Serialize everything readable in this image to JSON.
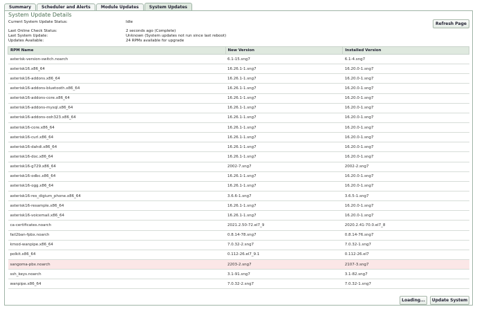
{
  "tabs": [
    {
      "label": "Summary",
      "active": false
    },
    {
      "label": "Scheduler and Alerts",
      "active": false
    },
    {
      "label": "Module Updates",
      "active": false
    },
    {
      "label": "System Updates",
      "active": true
    }
  ],
  "panel": {
    "title": "System Update Details",
    "status_label": "Current System Update Status:",
    "status_value": "Idle",
    "last_online_label": "Last Online Check Status:",
    "last_online_value": "2 seconds ago   (Complete)",
    "last_update_label": "Last System Update:",
    "last_update_value": "Unknown (System updates not run since last reboot)",
    "available_label": "Updates Available:",
    "available_value": "24 RPMs available for upgrade",
    "refresh_label": "Refresh Page"
  },
  "table": {
    "headers": [
      "RPM Name",
      "New Version",
      "Installed Version"
    ],
    "rows": [
      {
        "name": "asterisk-version-switch.noarch",
        "new": "6.1-15.sng7",
        "installed": "6.1-4.sng7"
      },
      {
        "name": "asterisk16.x86_64",
        "new": "16.26.1-1.sng7",
        "installed": "16.20.0-1.sng7"
      },
      {
        "name": "asterisk16-addons.x86_64",
        "new": "16.26.1-1.sng7",
        "installed": "16.20.0-1.sng7"
      },
      {
        "name": "asterisk16-addons-bluetooth.x86_64",
        "new": "16.26.1-1.sng7",
        "installed": "16.20.0-1.sng7"
      },
      {
        "name": "asterisk16-addons-core.x86_64",
        "new": "16.26.1-1.sng7",
        "installed": "16.20.0-1.sng7"
      },
      {
        "name": "asterisk16-addons-mysql.x86_64",
        "new": "16.26.1-1.sng7",
        "installed": "16.20.0-1.sng7"
      },
      {
        "name": "asterisk16-addons-ooh323.x86_64",
        "new": "16.26.1-1.sng7",
        "installed": "16.20.0-1.sng7"
      },
      {
        "name": "asterisk16-core.x86_64",
        "new": "16.26.1-1.sng7",
        "installed": "16.20.0-1.sng7"
      },
      {
        "name": "asterisk16-curl.x86_64",
        "new": "16.26.1-1.sng7",
        "installed": "16.20.0-1.sng7"
      },
      {
        "name": "asterisk16-dahdi.x86_64",
        "new": "16.26.1-1.sng7",
        "installed": "16.20.0-1.sng7"
      },
      {
        "name": "asterisk16-doc.x86_64",
        "new": "16.26.1-1.sng7",
        "installed": "16.20.0-1.sng7"
      },
      {
        "name": "asterisk16-g729.x86_64",
        "new": "2002-7.sng7",
        "installed": "2002-2.sng7"
      },
      {
        "name": "asterisk16-odbc.x86_64",
        "new": "16.26.1-1.sng7",
        "installed": "16.20.0-1.sng7"
      },
      {
        "name": "asterisk16-ogg.x86_64",
        "new": "16.26.1-1.sng7",
        "installed": "16.20.0-1.sng7"
      },
      {
        "name": "asterisk16-res_digium_phone.x86_64",
        "new": "3.6.6-1.sng7",
        "installed": "3.6.5-1.sng7"
      },
      {
        "name": "asterisk16-resample.x86_64",
        "new": "16.26.1-1.sng7",
        "installed": "16.20.0-1.sng7"
      },
      {
        "name": "asterisk16-voicemail.x86_64",
        "new": "16.26.1-1.sng7",
        "installed": "16.20.0-1.sng7"
      },
      {
        "name": "ca-certificates.noarch",
        "new": "2021.2.50-72.el7_9",
        "installed": "2020.2.41-70.0.el7_8"
      },
      {
        "name": "fail2ban-fpbx.noarch",
        "new": "0.8.14-78.sng7",
        "installed": "0.8.14-76.sng7"
      },
      {
        "name": "kmod-wanpipe.x86_64",
        "new": "7.0.32-2.sng7",
        "installed": "7.0.32-1.sng7"
      },
      {
        "name": "polkit.x86_64",
        "new": "0.112-26.el7_9.1",
        "installed": "0.112-26.el7"
      },
      {
        "name": "sangoma-pbx.noarch",
        "new": "2203-2.sng7",
        "installed": "2107-3.sng7",
        "highlight": true
      },
      {
        "name": "ssh_keys.noarch",
        "new": "3.1-91.sng7",
        "installed": "3.1-82.sng7"
      },
      {
        "name": "wanpipe.x86_64",
        "new": "7.0.32-2.sng7",
        "installed": "7.0.32-1.sng7"
      }
    ]
  },
  "footer": {
    "loading_label": "Loading...",
    "update_label": "Update System"
  }
}
